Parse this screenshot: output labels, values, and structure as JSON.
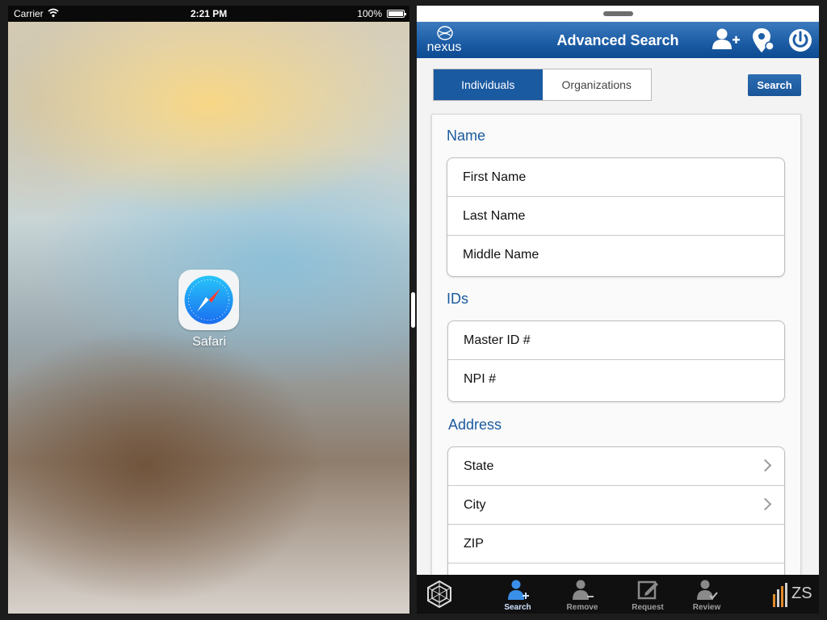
{
  "status_bar": {
    "carrier": "Carrier",
    "time": "2:21 PM",
    "battery": "100%"
  },
  "home_screen": {
    "app_label": "Safari",
    "app_icon": "safari-compass-icon"
  },
  "app": {
    "logo_text": "nexus",
    "title": "Advanced Search",
    "nav_icons": [
      "add-person-icon",
      "location-pin-icon",
      "power-icon"
    ],
    "segments": [
      {
        "label": "Individuals",
        "active": true
      },
      {
        "label": "Organizations",
        "active": false
      }
    ],
    "search_label": "Search",
    "sections": {
      "name": {
        "title": "Name",
        "fields": [
          "First Name",
          "Last Name",
          "Middle Name"
        ]
      },
      "ids": {
        "title": "IDs",
        "fields": [
          "Master ID #",
          "NPI #"
        ]
      },
      "address": {
        "title": "Address",
        "fields": [
          "State",
          "City",
          "ZIP"
        ]
      }
    },
    "tabs": [
      {
        "label": "Search",
        "icon": "search-person-icon",
        "active": true
      },
      {
        "label": "Remove",
        "icon": "remove-person-icon",
        "active": false
      },
      {
        "label": "Request",
        "icon": "edit-request-icon",
        "active": false
      },
      {
        "label": "Review",
        "icon": "review-person-icon",
        "active": false
      }
    ],
    "footer_brand": "ZS",
    "colors": {
      "accent": "#1a5aa0",
      "nav_bar": "#1d5ea6",
      "tab_bar": "#101010"
    }
  }
}
